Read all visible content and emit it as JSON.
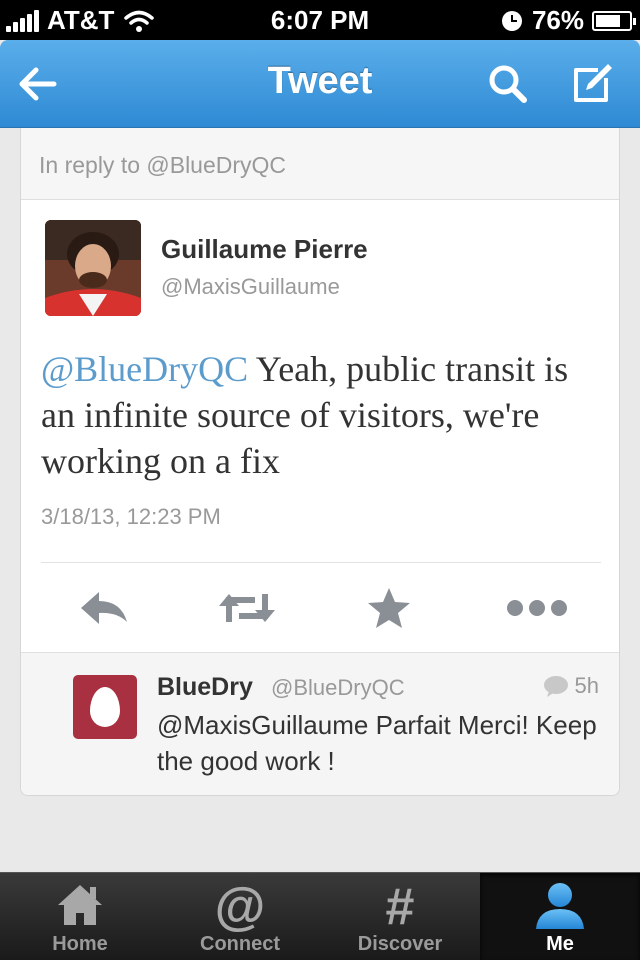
{
  "status_bar": {
    "carrier": "AT&T",
    "time": "6:07 PM",
    "battery": "76%",
    "battery_level": 0.76
  },
  "nav": {
    "title": "Tweet",
    "back_icon": "back-arrow-icon",
    "search_icon": "search-icon",
    "compose_icon": "compose-icon"
  },
  "tweet": {
    "in_reply_to": "In reply to @BlueDryQC",
    "author_name": "Guillaume Pierre",
    "author_handle": "@MaxisGuillaume",
    "mention": "@BlueDryQC",
    "text": " Yeah, public transit is an infinite source of visitors, we're working on a fix",
    "timestamp": "3/18/13, 12:23 PM",
    "actions": [
      "reply-icon",
      "retweet-icon",
      "favorite-star-icon",
      "more-dots-icon"
    ]
  },
  "reply": {
    "name": "BlueDry",
    "handle": "@BlueDryQC",
    "time": "5h",
    "text": "@MaxisGuillaume Parfait Merci! Keep the good work !"
  },
  "tab_bar": {
    "tabs": [
      {
        "label": "Home",
        "icon": "home-icon"
      },
      {
        "label": "Connect",
        "icon": "at-sign-icon"
      },
      {
        "label": "Discover",
        "icon": "hashtag-icon"
      },
      {
        "label": "Me",
        "icon": "person-icon",
        "selected": true
      }
    ]
  },
  "colors": {
    "nav_blue": "#3a95dc",
    "mention_blue": "#5b9ccd",
    "me_tab_blue": "#3b9ee6"
  }
}
